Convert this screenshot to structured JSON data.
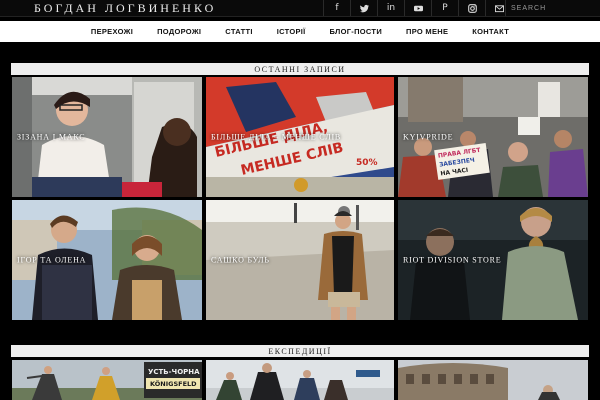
{
  "site": {
    "title": "БОГДАН ЛОГВИНЕНКО"
  },
  "socials": [
    {
      "name": "facebook-icon",
      "glyph": "f"
    },
    {
      "name": "twitter-icon",
      "glyph": "t"
    },
    {
      "name": "linkedin-icon",
      "glyph": "in"
    },
    {
      "name": "youtube-icon",
      "glyph": "▶"
    },
    {
      "name": "pinterest-icon",
      "glyph": "P"
    },
    {
      "name": "instagram-icon",
      "glyph": "◎"
    },
    {
      "name": "mail-icon",
      "glyph": "✉"
    }
  ],
  "search": {
    "placeholder": "SEARCH"
  },
  "nav": [
    "ПЕРЕХОЖІ",
    "ПОДОРОЖІ",
    "СТАТТІ",
    "ІСТОРІЇ",
    "БЛОГ-ПОСТИ",
    "ПРО МЕНЕ",
    "КОНТАКТ"
  ],
  "sections": {
    "latest": "ОСТАННІ ЗАПИСИ",
    "expeditions": "ЕКСПЕДИЦІЇ"
  },
  "latest_posts": [
    "ЗІЗАНА І МАКС",
    "БІЛЬШЕ ДІЛА – МЕНШЕ СЛІВ",
    "KYIVPRIDE",
    "ІГОР ТА ОЛЕНА",
    "САШКО БУЛЬ",
    "RIOT DIVISION STORE"
  ],
  "poster_text": {
    "line1": "БІЛЬШЕ ДІЛА,",
    "line2": "МЕНШЕ СЛІВ",
    "num": "50%"
  },
  "protest_sign": {
    "line1": "ПРАВА ЛГБТ",
    "line2": "ЗАБЕЗПЕЧ",
    "line3": "НА ЧАСІ"
  },
  "road_sign": {
    "line1": "УСТЬ-ЧОРНА",
    "line2": "KÖNIGSFELD"
  }
}
